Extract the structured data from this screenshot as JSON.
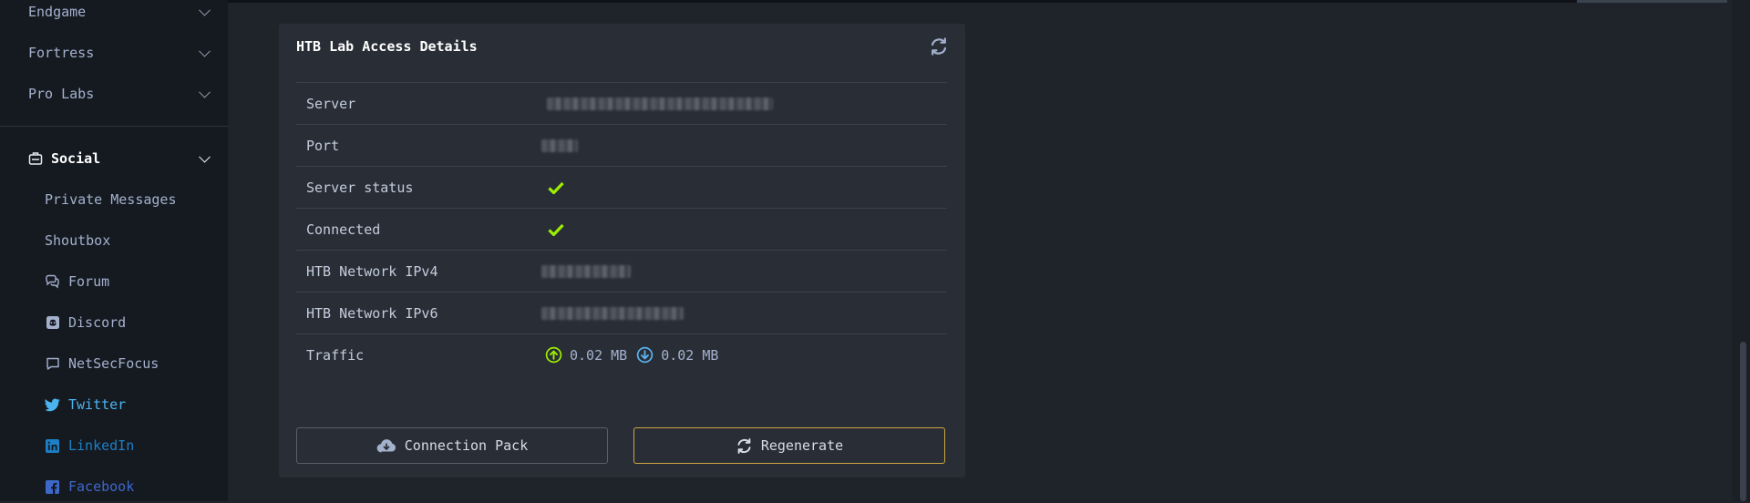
{
  "sidebar": {
    "top_items": [
      {
        "label": "Endgame"
      },
      {
        "label": "Fortress"
      },
      {
        "label": "Pro Labs"
      }
    ],
    "social": {
      "label": "Social",
      "items": [
        {
          "label": "Private Messages",
          "icon": ""
        },
        {
          "label": "Shoutbox",
          "icon": ""
        },
        {
          "label": "Forum",
          "icon": "forum-icon"
        },
        {
          "label": "Discord",
          "icon": "discord-icon"
        },
        {
          "label": "NetSecFocus",
          "icon": "chat-bubble-icon"
        },
        {
          "label": "Twitter",
          "icon": "twitter-icon",
          "color": "#4bb4f0"
        },
        {
          "label": "LinkedIn",
          "icon": "linkedin-icon",
          "color": "#1d7fc6"
        },
        {
          "label": "Facebook",
          "icon": "facebook-icon",
          "color": "#3d68c8"
        }
      ]
    }
  },
  "card": {
    "title": "HTB Lab Access Details",
    "rows": [
      {
        "key": "Server"
      },
      {
        "key": "Port"
      },
      {
        "key": "Server status"
      },
      {
        "key": "Connected"
      },
      {
        "key": "HTB Network IPv4"
      },
      {
        "key": "HTB Network IPv6"
      },
      {
        "key": "Traffic",
        "upload": "0.02 MB",
        "download": "0.02 MB"
      }
    ],
    "buttons": {
      "connection_pack": "Connection Pack",
      "regenerate": "Regenerate"
    }
  },
  "colors": {
    "check": "#9fef00",
    "upload": "#9fef00",
    "download": "#5cb2f0",
    "regenerate_border": "#caa440"
  }
}
